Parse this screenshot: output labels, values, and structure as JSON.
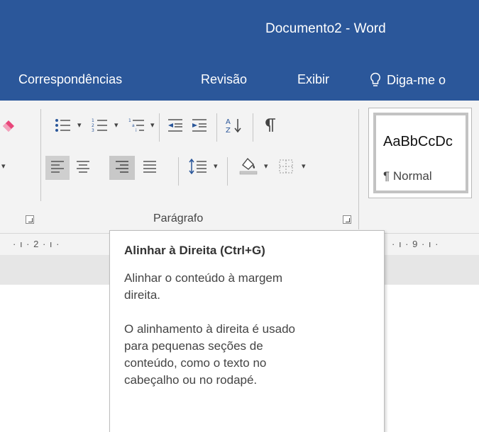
{
  "window": {
    "title": "Documento2  -  Word"
  },
  "ribbon_tabs": [
    {
      "label": "Correspondências"
    },
    {
      "label": "Revisão"
    },
    {
      "label": "Exibir"
    },
    {
      "label": "Diga-me o",
      "icon": "lightbulb-icon"
    }
  ],
  "paragraph_group": {
    "label": "Parágrafo",
    "active_button": "align-right-button",
    "buttons": [
      "eraser-icon",
      "bullets-icon",
      "numbering-icon",
      "multilevel-list-icon",
      "decrease-indent-icon",
      "increase-indent-icon",
      "sort-icon",
      "pilcrow-icon",
      "align-left-icon",
      "align-center-icon",
      "align-right-icon",
      "justify-icon",
      "line-spacing-icon",
      "shading-icon",
      "borders-icon"
    ]
  },
  "styles_gallery": {
    "preview": "AaBbCcDc",
    "style_name": "¶ Normal"
  },
  "ruler": {
    "left_marks": "· ı · 2 · ı · ",
    "right_marks": "· ı · 9 · ı ·"
  },
  "tooltip": {
    "title": "Alinhar à Direita (Ctrl+G)",
    "line1": "Alinhar o conteúdo à margem",
    "line2": "direita.",
    "line3": "O alinhamento à direita é usado",
    "line4": "para pequenas seções de",
    "line5": "conteúdo, como o texto no",
    "line6": "cabeçalho ou no rodapé."
  },
  "colors": {
    "title_bar": "#2b579a",
    "ribbon": "#f3f3f3",
    "active_button": "#c8c8c8"
  }
}
